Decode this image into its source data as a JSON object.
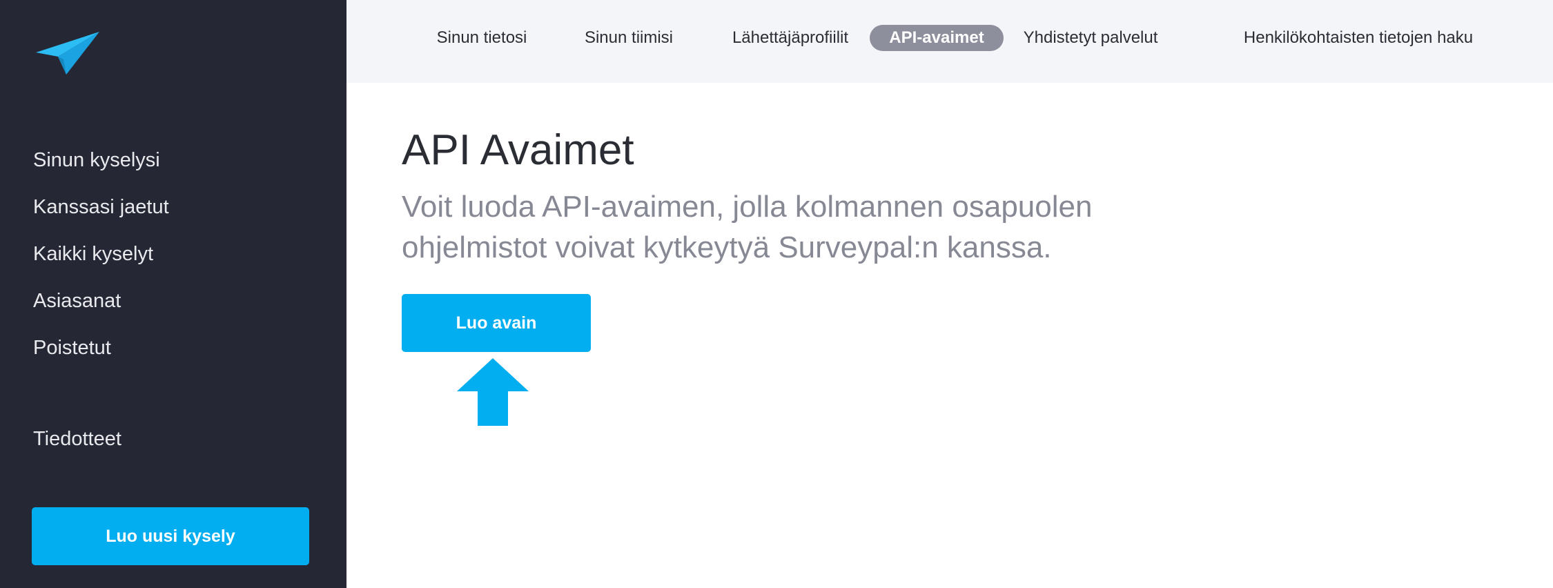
{
  "colors": {
    "sidebar_bg": "#252834",
    "accent": "#03aef0",
    "topbar_bg": "#f4f5f8",
    "active_tab_bg": "#8d8f9c",
    "title": "#2b2d35",
    "subtitle": "#868894"
  },
  "logo": {
    "icon": "paper-plane-icon"
  },
  "sidebar": {
    "items": [
      {
        "label": "Sinun kyselysi"
      },
      {
        "label": "Kanssasi jaetut"
      },
      {
        "label": "Kaikki kyselyt"
      },
      {
        "label": "Asiasanat"
      },
      {
        "label": "Poistetut"
      },
      {
        "label": "Tiedotteet"
      }
    ],
    "new_survey_button": "Luo uusi kysely"
  },
  "topnav": {
    "tabs": [
      {
        "label": "Sinun tietosi"
      },
      {
        "label": "Sinun tiimisi"
      },
      {
        "label": "Lähettäjäprofiilit"
      },
      {
        "label": "API-avaimet",
        "active": true
      },
      {
        "label": "Yhdistetyt palvelut"
      },
      {
        "label": "Henkilökohtaisten tietojen haku"
      }
    ]
  },
  "main": {
    "title": "API Avaimet",
    "description": "Voit luoda API-avaimen, jolla kolmannen osapuolen ohjelmistot voivat kytkeytyä Surveypal:n kanssa.",
    "create_key_button": "Luo avain",
    "pointer": "arrow-up-icon"
  }
}
